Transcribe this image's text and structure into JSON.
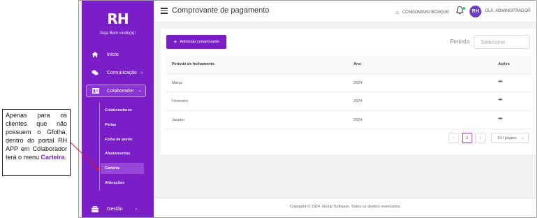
{
  "app": {
    "logo": "RH",
    "welcome": "Seja Bem vindo(a)!"
  },
  "sidebar": {
    "items": [
      {
        "label": "Início",
        "icon": "home-icon"
      },
      {
        "label": "Comunicação",
        "icon": "chat-icon",
        "chevron": "›"
      },
      {
        "label": "Colaborador",
        "icon": "id-card-icon",
        "chevron": "⌄"
      },
      {
        "label": "Gestão",
        "icon": "briefcase-icon",
        "chevron": "›"
      }
    ],
    "submenu": [
      "Colaboradores",
      "Férias",
      "Folha de ponto",
      "Afastamentos",
      "Carteira",
      "Alterações"
    ],
    "active_submenu": "Carteira"
  },
  "topbar": {
    "title": "Comprovante de pagamento",
    "condominium": "CONDOMINIO BOSQUE",
    "avatar_initials": "RH",
    "user_greeting": "OLÁ, ADMINISTRADOR"
  },
  "toolbar": {
    "add_label": "Adicionar comprovante",
    "period_label": "Período",
    "period_placeholder": "Selecione"
  },
  "table": {
    "headers": [
      "Período de fechamento",
      "Ano",
      "Ações"
    ],
    "rows": [
      {
        "period": "Março",
        "year": "2024",
        "actions": "•••"
      },
      {
        "period": "Fevereiro",
        "year": "2024",
        "actions": "•••"
      },
      {
        "period": "Janeiro",
        "year": "2024",
        "actions": "•••"
      }
    ]
  },
  "pagination": {
    "prev": "‹",
    "current": "1",
    "next": "›",
    "page_size": "10 / página"
  },
  "footer": {
    "text": "Copyright © 2024. Group Software. Todos os direitos reservados."
  },
  "annotation": {
    "text": "Apenas para os clientes que não possuem o Gfolha, dentro do portal RH APP em Colaborador terá o menu",
    "highlight": "Carteira",
    "end": "."
  },
  "colors": {
    "brand": "#7a1fc7",
    "sidebar_bg": "#7a1fc7",
    "status_dot": "#2ecc71",
    "arrow": "#e0162b"
  }
}
